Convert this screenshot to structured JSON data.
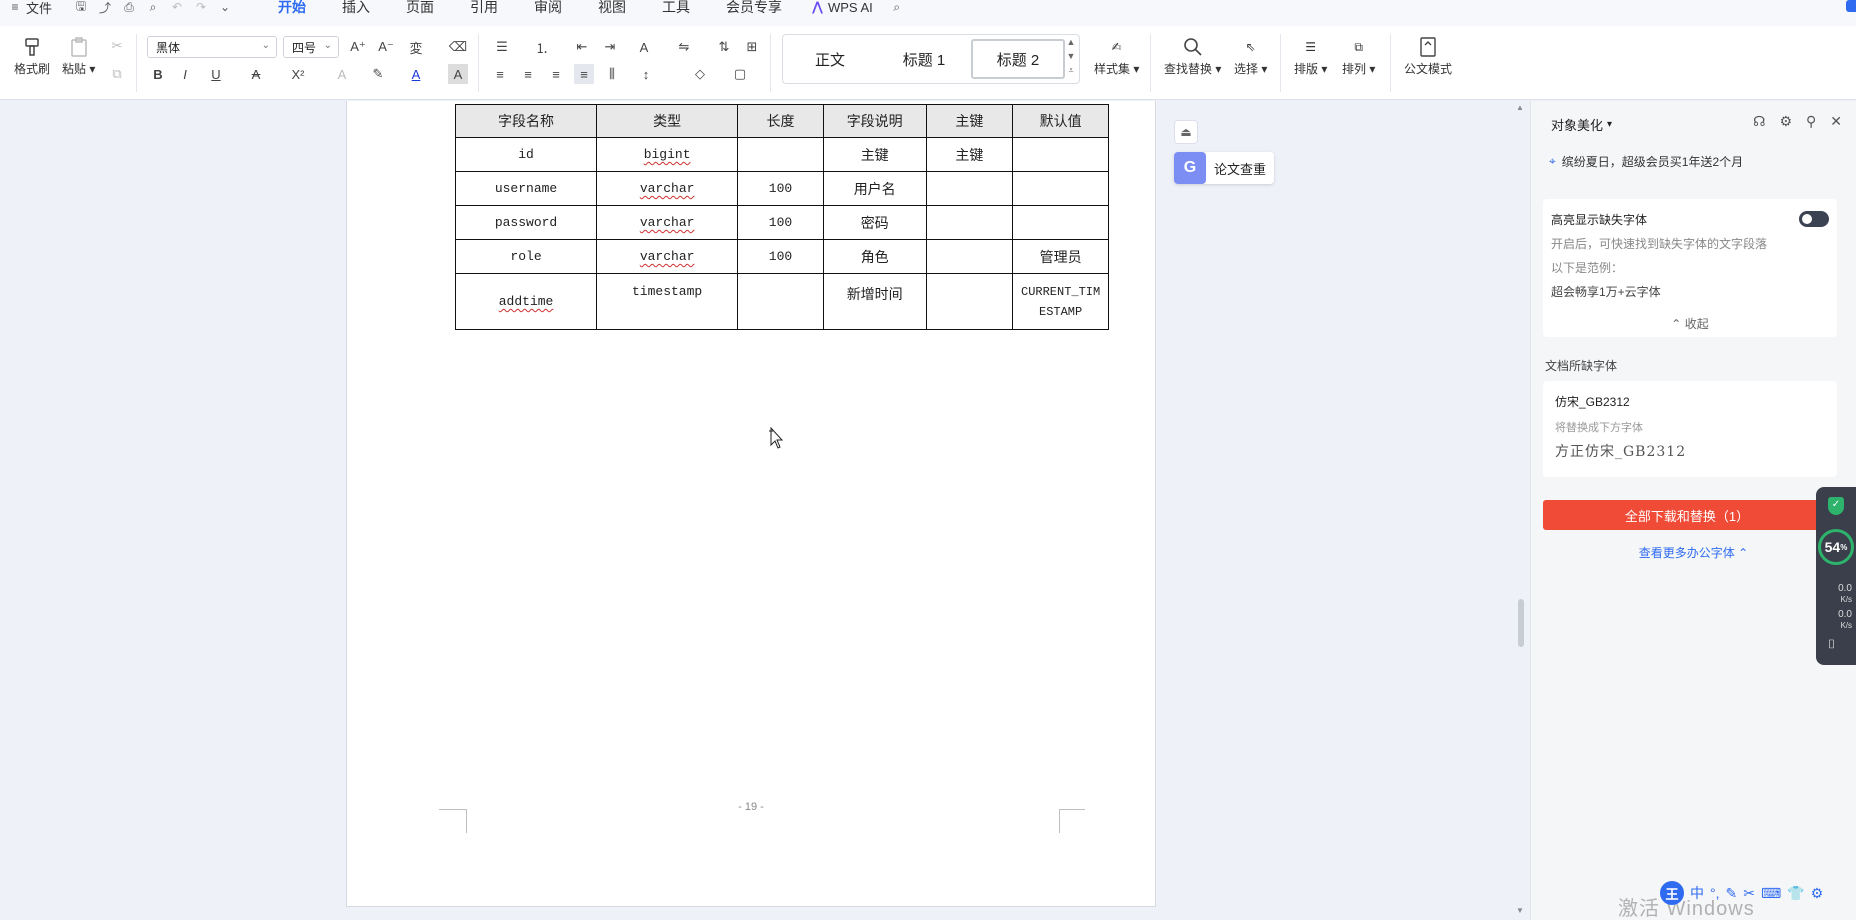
{
  "menubar": {
    "file_label": "文件",
    "tabs": [
      {
        "label": "开始"
      },
      {
        "label": "插入"
      },
      {
        "label": "页面"
      },
      {
        "label": "引用"
      },
      {
        "label": "审阅"
      },
      {
        "label": "视图"
      },
      {
        "label": "工具"
      },
      {
        "label": "会员专享"
      }
    ],
    "wps_ai_label": "WPS AI"
  },
  "ribbon": {
    "format_painter": "格式刷",
    "paste": "粘贴",
    "font_name": "黑体",
    "font_size": "四号",
    "styles": [
      "正文",
      "标题 1",
      "标题 2"
    ],
    "style_set": "样式集",
    "find_replace": "查找替换",
    "select": "选择",
    "layout": "排版",
    "arrange": "排列",
    "official_mode": "公文模式"
  },
  "table": {
    "headers": [
      "字段名称",
      "类型",
      "长度",
      "字段说明",
      "主键",
      "默认值"
    ],
    "rows": [
      [
        "id",
        "bigint",
        "",
        "主键",
        "主键",
        ""
      ],
      [
        "username",
        "varchar",
        "100",
        "用户名",
        "",
        ""
      ],
      [
        "password",
        "varchar",
        "100",
        "密码",
        "",
        ""
      ],
      [
        "role",
        "varchar",
        "100",
        "角色",
        "",
        "管理员"
      ],
      [
        "addtime",
        "timestamp",
        "",
        "新增时间",
        "",
        "CURRENT_TIMESTAMP"
      ]
    ],
    "last_default_line1": "CURRENT_TIM",
    "last_default_line2": "ESTAMP"
  },
  "page": {
    "page_number": "- 19 -"
  },
  "float": {
    "paper_check": "论文查重"
  },
  "panel": {
    "title": "对象美化",
    "promo": "缤纷夏日，超级会员买1年送2个月",
    "highlight_title": "高亮显示缺失字体",
    "highlight_desc": "开启后，可快速找到缺失字体的文字段落",
    "example_label": "以下是范例：",
    "example_text": "超会畅享1万+云字体",
    "collapse": "收起",
    "missing_section": "文档所缺字体",
    "missing_font": "仿宋_GB2312",
    "replace_hint": "将替换成下方字体",
    "replace_font": "方正仿宋_GB2312",
    "download_button": "全部下载和替换（1）",
    "more_link": "查看更多办公字体"
  },
  "speed_widget": {
    "percent": "54",
    "percent_suffix": "%",
    "up": "0.0",
    "up_unit": "K/s",
    "down": "0.0",
    "down_unit": "K/s"
  },
  "system": {
    "watermark": "激活 Windows",
    "ime_label": "王",
    "ime_mode": "中"
  },
  "colors": {
    "accent": "#2f6bf0",
    "download_button": "#f04b37"
  }
}
